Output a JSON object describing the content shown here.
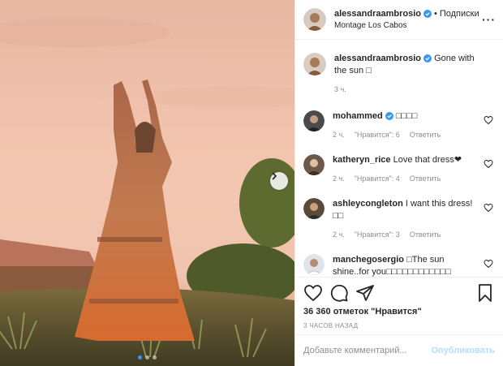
{
  "colors": {
    "accent": "#3897f0",
    "muted": "#8e8e8e",
    "border": "#efefef"
  },
  "photo": {
    "slides": 3,
    "active_slide": 1,
    "next_icon": "chevron-right-icon"
  },
  "header": {
    "username": "alessandraambrosio",
    "follow_label": "Подписки",
    "location": "Montage Los Cabos",
    "more_icon": "more-icon"
  },
  "caption": {
    "username": "alessandraambrosio",
    "text": "Gone with the sun ",
    "emoji": "□",
    "time": "3 ч."
  },
  "comments": [
    {
      "username": "mohammed",
      "verified": true,
      "text": "□□□□",
      "time": "2 ч.",
      "likes": "\"Нравится\": 6",
      "reply": "Ответить"
    },
    {
      "username": "katheryn_rice",
      "verified": false,
      "text": "Love that dress❤",
      "time": "2 ч.",
      "likes": "\"Нравится\": 4",
      "reply": "Ответить"
    },
    {
      "username": "ashleycongleton",
      "verified": false,
      "text": "I want this dress! □□",
      "time": "2 ч.",
      "likes": "\"Нравится\": 3",
      "reply": "Ответить"
    },
    {
      "username": "manchegosergio",
      "verified": false,
      "text": "□The sun shine..for you□□□□□□□□□□□□",
      "time": "",
      "likes": "",
      "reply": ""
    }
  ],
  "actions": {
    "like_icon": "heart-icon",
    "comment_icon": "comment-icon",
    "share_icon": "share-icon",
    "save_icon": "bookmark-icon"
  },
  "likes_text": "36 360 отметок \"Нравится\"",
  "post_time": "3 ЧАСОВ НАЗАД",
  "add_comment": {
    "placeholder": "Добавьте комментарий...",
    "publish_label": "Опубликовать"
  }
}
